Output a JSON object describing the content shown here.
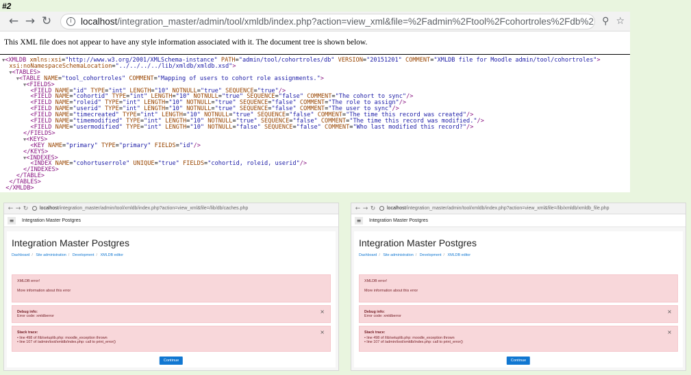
{
  "label": "#2",
  "top_window": {
    "url_host": "localhost",
    "url_path": "/integration_master/admin/tool/xmldb/index.php?action=view_xml&file=%2Fadmin%2Ftool%2Fcohortroles%2Fdb%2Finstall.xml",
    "notice": "This XML file does not appear to have any style information associated with it. The document tree is shown below.",
    "xml": {
      "root": {
        "xmlns": "http://www.w3.org/2001/XMLSchema-instance",
        "path": "admin/tool/cohortroles/db",
        "version": "20151201",
        "comment": "XMLDB file for Moodle admin/tool/cohortroles",
        "nsloc": "../../../../lib/xmldb/xmldb.xsd"
      },
      "table": {
        "name": "tool_cohortroles",
        "comment": "Mapping of users to cohort role assignments."
      },
      "fields": [
        {
          "name": "id",
          "type": "int",
          "length": "10",
          "notnull": "true",
          "sequence": "true",
          "comment": ""
        },
        {
          "name": "cohortid",
          "type": "int",
          "length": "10",
          "notnull": "true",
          "sequence": "false",
          "comment": "The cohort to sync"
        },
        {
          "name": "roleid",
          "type": "int",
          "length": "10",
          "notnull": "true",
          "sequence": "false",
          "comment": "The role to assign"
        },
        {
          "name": "userid",
          "type": "int",
          "length": "10",
          "notnull": "true",
          "sequence": "false",
          "comment": "The user to sync"
        },
        {
          "name": "timecreated",
          "type": "int",
          "length": "10",
          "notnull": "true",
          "sequence": "false",
          "comment": "The time this record was created"
        },
        {
          "name": "timemodified",
          "type": "int",
          "length": "10",
          "notnull": "true",
          "sequence": "false",
          "comment": "The time this record was modified."
        },
        {
          "name": "usermodified",
          "type": "int",
          "length": "10",
          "notnull": "false",
          "sequence": "false",
          "comment": "Who last modified this record?"
        }
      ],
      "key": {
        "name": "primary",
        "type": "primary",
        "fields": "id"
      },
      "index": {
        "name": "cohortuserrole",
        "unique": "true",
        "fields": "cohortid, roleid, userid"
      }
    }
  },
  "left_window": {
    "url_host": "localhost",
    "url_path": "/integration_master/admin/tool/xmldb/index.php?action=view_xml&file=/lib/db/caches.php"
  },
  "right_window": {
    "url_host": "localhost",
    "url_path": "/integration_master/admin/tool/xmldb/index.php?action=view_xml&file=/lib/xmldb/xmldb_file.php"
  },
  "moodle": {
    "site_name": "Integration Master Postgres",
    "page_title": "Integration Master Postgres",
    "breadcrumbs": [
      "Dashboard",
      "Site administration",
      "Development",
      "XMLDB editor"
    ],
    "error_title": "XMLDB error!",
    "error_more": "More information about this error",
    "debug_label": "Debug info:",
    "debug_text": "Error code: xmldberror",
    "stack_label": "Stack trace:",
    "stack": [
      "line 498 of /lib/setuplib.php: moodle_exception thrown",
      "line 107 of /admin/tool/xmldb/index.php: call to print_error()"
    ],
    "continue_label": "Continue"
  }
}
